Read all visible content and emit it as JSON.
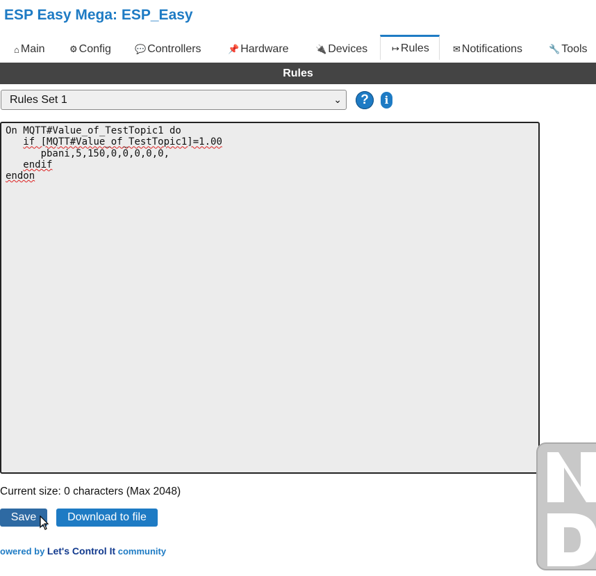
{
  "app": {
    "title": "ESP Easy Mega: ESP_Easy"
  },
  "tabs": [
    {
      "icon": "house-icon",
      "glyph": "⌂",
      "label": "Main"
    },
    {
      "icon": "gear-icon",
      "glyph": "⚙",
      "label": "Config"
    },
    {
      "icon": "chat-icon",
      "glyph": "💬",
      "label": "Controllers"
    },
    {
      "icon": "pin-icon",
      "glyph": "📌",
      "label": "Hardware"
    },
    {
      "icon": "plug-icon",
      "glyph": "🔌",
      "label": "Devices"
    },
    {
      "icon": "arrow-icon",
      "glyph": "↦",
      "label": "Rules",
      "active": true
    },
    {
      "icon": "envelope-icon",
      "glyph": "✉",
      "label": "Notifications"
    },
    {
      "icon": "wrench-icon",
      "glyph": "🔧",
      "label": "Tools"
    }
  ],
  "header": {
    "title": "Rules"
  },
  "rules_select": {
    "selected": "Rules Set 1"
  },
  "help": {
    "help_glyph": "?",
    "info_glyph": "i"
  },
  "editor": {
    "lines": [
      "On MQTT#Value_of_TestTopic1 do",
      "if [MQTT#Value_of_TestTopic1]=1.00",
      "pbani,5,150,0,0,0,0,0,",
      "endif",
      "endon"
    ]
  },
  "status": {
    "current_size": "Current size: 0 characters (Max 2048)"
  },
  "buttons": {
    "save": "Save",
    "download": "Download to file"
  },
  "footer": {
    "prefix": "owered by",
    "brand": "Let's Control It",
    "suffix": "community"
  },
  "colors": {
    "accent": "#1e7bc4",
    "header_bar": "#444444",
    "save_button": "#2e6aa3"
  }
}
